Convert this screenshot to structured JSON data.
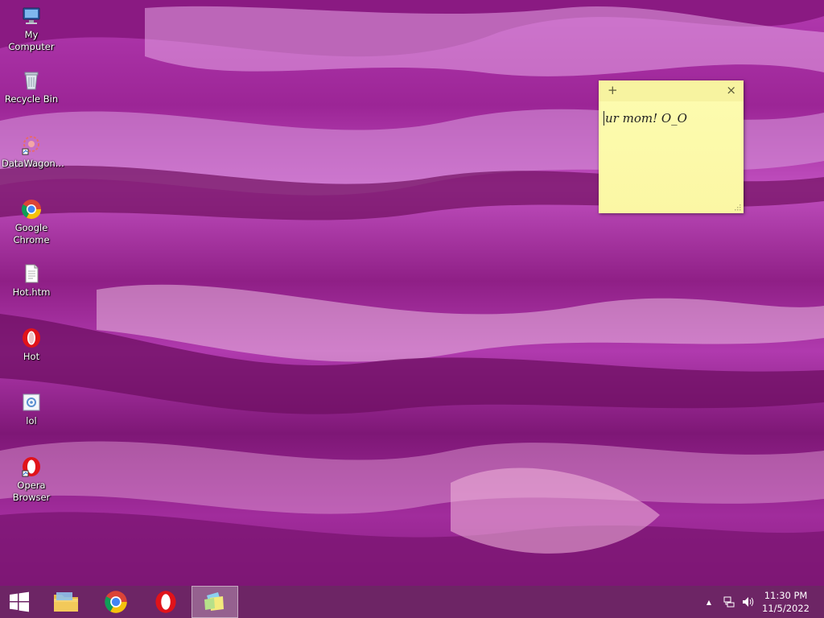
{
  "desktop": {
    "icons": [
      {
        "label": "My Computer",
        "icon": "computer-icon"
      },
      {
        "label": "Recycle Bin",
        "icon": "recycle-bin-icon"
      },
      {
        "label": "DataWagon...",
        "icon": "datawagon-icon"
      },
      {
        "label": "Google Chrome",
        "icon": "chrome-icon"
      },
      {
        "label": "Hot.htm",
        "icon": "html-file-icon"
      },
      {
        "label": "Hot",
        "icon": "opera-icon"
      },
      {
        "label": "lol",
        "icon": "settings-file-icon"
      },
      {
        "label": "Opera Browser",
        "icon": "opera-icon"
      }
    ]
  },
  "sticky_note": {
    "add_glyph": "+",
    "close_glyph": "×",
    "text": "ur mom! O_O"
  },
  "taskbar": {
    "buttons": [
      {
        "name": "start",
        "icon": "windows-logo-icon"
      },
      {
        "name": "file-explorer",
        "icon": "folder-icon"
      },
      {
        "name": "chrome",
        "icon": "chrome-icon"
      },
      {
        "name": "opera",
        "icon": "opera-icon"
      },
      {
        "name": "sticky-notes",
        "icon": "sticky-notes-icon",
        "active": true
      }
    ],
    "tray": {
      "overflow_glyph": "▲",
      "time": "11:30 PM",
      "date": "11/5/2022"
    }
  },
  "colors": {
    "taskbar": "#6d2565",
    "sticky_note": "#fbf7a4",
    "wallpaper_primary": "#a12c9c"
  }
}
